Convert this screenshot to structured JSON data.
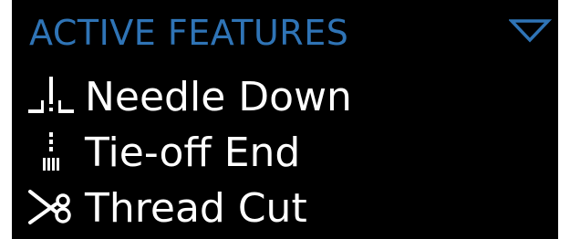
{
  "panel": {
    "title": "ACTIVE FEATURES",
    "toggle_icon": "triangle-down-icon",
    "accent_color": "#2f74b6",
    "background_color": "#000000",
    "text_color": "#ffffff"
  },
  "features": [
    {
      "label": "Needle Down",
      "icon": "needle-down-icon"
    },
    {
      "label": "Tie-off End",
      "icon": "tie-off-end-icon"
    },
    {
      "label": "Thread Cut",
      "icon": "scissors-icon"
    }
  ]
}
